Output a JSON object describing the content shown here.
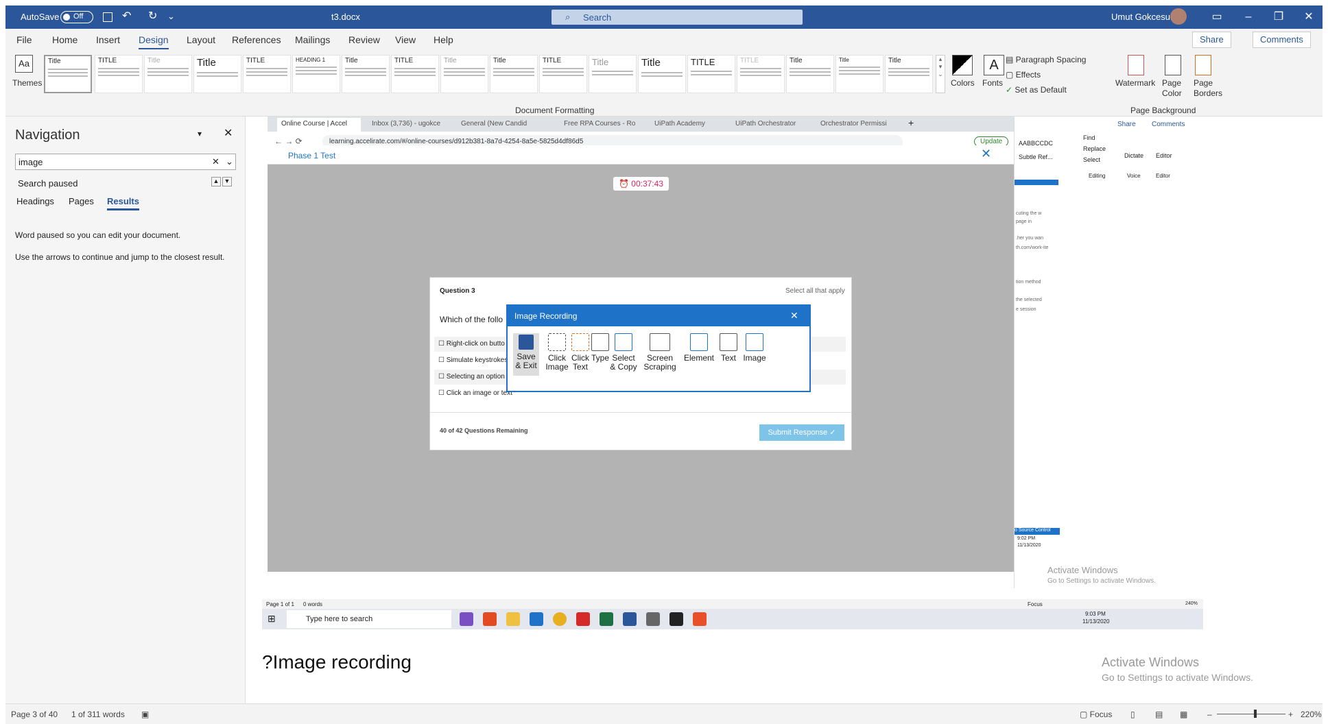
{
  "titlebar": {
    "autosave": "AutoSave",
    "autosave_state": "Off",
    "doc_title": "t3.docx",
    "search_placeholder": "Search",
    "user": "Umut Gokcesu"
  },
  "menu": {
    "items": [
      "File",
      "Home",
      "Insert",
      "Design",
      "Layout",
      "References",
      "Mailings",
      "Review",
      "View",
      "Help"
    ],
    "active": "Design",
    "share": "Share",
    "comments": "Comments"
  },
  "ribbon": {
    "themes": "Themes",
    "document_formatting": "Document Formatting",
    "gallery": [
      "Title",
      "TITLE",
      "Title",
      "Title",
      "TITLE",
      "HEADING 1",
      "Title",
      "TITLE",
      "Title",
      "Title",
      "TITLE",
      "Title",
      "Title",
      "TITLE",
      "TITLE",
      "Title",
      "Title",
      "Title"
    ],
    "colors": "Colors",
    "fonts": "Fonts",
    "paragraph_spacing": "Paragraph Spacing",
    "effects": "Effects",
    "set_as_default": "Set as Default",
    "watermark": "Watermark",
    "page_color": "Page Color",
    "page_borders": "Page Borders",
    "page_background": "Page Background"
  },
  "nav": {
    "title": "Navigation",
    "search_value": "image",
    "status": "Search paused",
    "tabs": [
      "Headings",
      "Pages",
      "Results"
    ],
    "active_tab": "Results",
    "msg1": "Word paused so you can edit your document.",
    "msg2": "Use the arrows to continue and jump to the closest result."
  },
  "browser": {
    "tabs": [
      "Online Course | Accel",
      "Inbox (3,736) - ugokce",
      "General (New Candid",
      "Free RPA Courses - Ro",
      "UiPath Academy",
      "UiPath Orchestrator",
      "Orchestrator Permissi"
    ],
    "url": "learning.accelirate.com/#/online-courses/d912b381-8a7d-4254-8a5e-5825d4df86d5",
    "update": "Update",
    "phase": "Phase 1 Test",
    "timer": "00:37:43"
  },
  "question": {
    "number": "Question 3",
    "instruction": "Select all that apply",
    "text": "Which of the follo",
    "options": [
      "Right-click on butto",
      "Simulate keystrokes",
      "Selecting an option",
      "Click an image or text"
    ],
    "remaining": "40 of 42 Questions Remaining",
    "submit": "Submit Response"
  },
  "recorder": {
    "title": "Image Recording",
    "save": "Save & Exit",
    "tools": [
      "Click Image",
      "Click Text",
      "Type",
      "Select & Copy",
      "Screen Scraping",
      "Element",
      "Text",
      "Image"
    ]
  },
  "word_inner": {
    "share": "Share",
    "comments": "Comments",
    "find": "Find",
    "replace": "Replace",
    "select": "Select",
    "dictate": "Dictate",
    "editor": "Editor",
    "editing": "Editing",
    "voice": "Voice",
    "styles": [
      "AABBCCDC",
      "Subtle Ref..."
    ],
    "snippets": [
      "cuting the w",
      "page in ",
      ".her you wan",
      "th.com/work-ite",
      "tion method",
      "the selected ",
      "e session"
    ],
    "source_control": "o Source Control",
    "time": "9:02 PM",
    "date": "11/13/2020",
    "activate": "Activate Windows",
    "activate_sub": "Go to Settings to activate Windows."
  },
  "inner_status": {
    "page": "Page 1 of 1",
    "words": "0 words",
    "focus": "Focus",
    "zoom": "240%"
  },
  "taskbar": {
    "search": "Type here to search",
    "time": "9:03 PM",
    "date": "11/13/2020"
  },
  "doc": {
    "heading": "?Image recording",
    "activate": "Activate Windows",
    "activate_sub": "Go to Settings to activate Windows."
  },
  "status": {
    "page": "Page 3 of 40",
    "words": "1 of 311 words",
    "focus": "Focus",
    "zoom": "220%"
  }
}
